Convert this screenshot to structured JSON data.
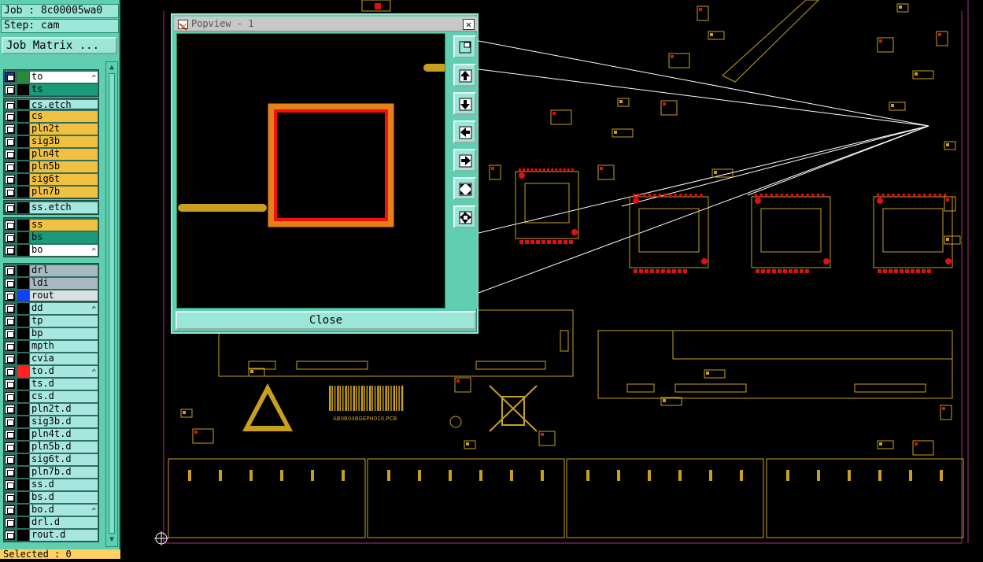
{
  "job": {
    "label": "Job : 8c00005wa0"
  },
  "step": {
    "label": "Step: cam"
  },
  "job_matrix": {
    "label": "Job Matrix ..."
  },
  "layers": [
    {
      "name": "to",
      "color": "#2a8a3a",
      "row_bg": "#ffffff",
      "icon": "✍"
    },
    {
      "name": "ts",
      "color": "#000000",
      "row_bg": "#1a9a7a"
    },
    {
      "name": "cs.etch",
      "color": "#000000",
      "row_bg": "#a8e6e0"
    },
    {
      "name": "cs",
      "color": "#000000",
      "row_bg": "#f0c040"
    },
    {
      "name": "pln2t",
      "color": "#000000",
      "row_bg": "#f0c040"
    },
    {
      "name": "sig3b",
      "color": "#000000",
      "row_bg": "#f0c040"
    },
    {
      "name": "pln4t",
      "color": "#000000",
      "row_bg": "#f0c040"
    },
    {
      "name": "pln5b",
      "color": "#000000",
      "row_bg": "#f0c040"
    },
    {
      "name": "sig6t",
      "color": "#000000",
      "row_bg": "#f0c040"
    },
    {
      "name": "pln7b",
      "color": "#000000",
      "row_bg": "#f0c040"
    },
    {
      "name": "ss.etch",
      "color": "#000000",
      "row_bg": "#a8e6e0"
    },
    {
      "name": "ss",
      "color": "#000000",
      "row_bg": "#f0c040"
    },
    {
      "name": "bs",
      "color": "#000000",
      "row_bg": "#1a9a7a"
    },
    {
      "name": "bo",
      "color": "#000000",
      "row_bg": "#ffffff",
      "icon": "✍"
    },
    {
      "name": "drl",
      "color": "#000000",
      "row_bg": "#a8b8c0"
    },
    {
      "name": "ldi",
      "color": "#000000",
      "row_bg": "#a8b8c0"
    },
    {
      "name": "rout",
      "color": "#1040ff",
      "row_bg": "#d8e0e0"
    },
    {
      "name": "dd",
      "color": "#000000",
      "row_bg": "#a8e6e0",
      "icon": "✍"
    },
    {
      "name": "tp",
      "color": "#000000",
      "row_bg": "#a8e6e0"
    },
    {
      "name": "bp",
      "color": "#000000",
      "row_bg": "#a8e6e0"
    },
    {
      "name": "mpth",
      "color": "#000000",
      "row_bg": "#a8e6e0"
    },
    {
      "name": "cvia",
      "color": "#000000",
      "row_bg": "#a8e6e0"
    },
    {
      "name": "to.d",
      "color": "#ff2020",
      "row_bg": "#a8e6e0",
      "icon": "✍"
    },
    {
      "name": "ts.d",
      "color": "#000000",
      "row_bg": "#a8e6e0"
    },
    {
      "name": "cs.d",
      "color": "#000000",
      "row_bg": "#a8e6e0"
    },
    {
      "name": "pln2t.d",
      "color": "#000000",
      "row_bg": "#a8e6e0"
    },
    {
      "name": "sig3b.d",
      "color": "#000000",
      "row_bg": "#a8e6e0"
    },
    {
      "name": "pln4t.d",
      "color": "#000000",
      "row_bg": "#a8e6e0"
    },
    {
      "name": "pln5b.d",
      "color": "#000000",
      "row_bg": "#a8e6e0"
    },
    {
      "name": "sig6t.d",
      "color": "#000000",
      "row_bg": "#a8e6e0"
    },
    {
      "name": "pln7b.d",
      "color": "#000000",
      "row_bg": "#a8e6e0"
    },
    {
      "name": "ss.d",
      "color": "#000000",
      "row_bg": "#a8e6e0"
    },
    {
      "name": "bs.d",
      "color": "#000000",
      "row_bg": "#a8e6e0"
    },
    {
      "name": "bo.d",
      "color": "#000000",
      "row_bg": "#a8e6e0",
      "icon": "✍"
    },
    {
      "name": "drl.d",
      "color": "#000000",
      "row_bg": "#a8e6e0"
    },
    {
      "name": "rout.d",
      "color": "#000000",
      "row_bg": "#a8e6e0"
    }
  ],
  "status": {
    "selected": "Selected : 0"
  },
  "popview": {
    "title": "Popview - 1",
    "close_label": "Close",
    "tools": [
      "zoom-fit-icon",
      "pan-up-icon",
      "pan-down-icon",
      "pan-left-icon",
      "pan-right-icon",
      "zoom-out-icon",
      "zoom-in-icon"
    ]
  },
  "board": {
    "barcode_text": "AB0B04BGEPH010.PCB",
    "copper_color": "#c8a020",
    "pad_color": "#e01010",
    "outline_color": "#b03080"
  }
}
